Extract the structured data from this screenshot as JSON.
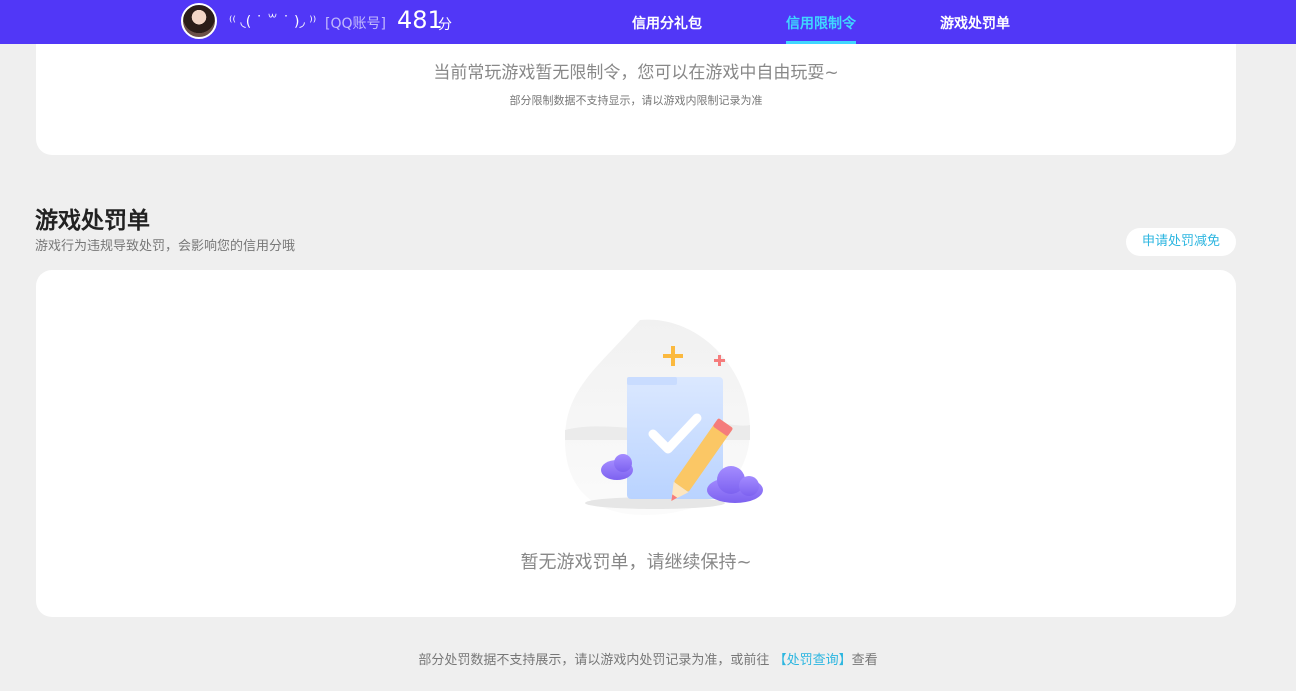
{
  "header": {
    "nickname": "⁽⁽ ◟( ˙ ꒳ ˙ )◞ ⁾⁾",
    "account_type": "[QQ账号]",
    "score": "481",
    "score_unit": "分",
    "tabs": [
      {
        "label": "信用分礼包",
        "active": false
      },
      {
        "label": "信用限制令",
        "active": true
      },
      {
        "label": "游戏处罚单",
        "active": false
      }
    ]
  },
  "limit_card": {
    "message": "当前常玩游戏暂无限制令，您可以在游戏中自由玩耍~",
    "note": "部分限制数据不支持显示，请以游戏内限制记录为准"
  },
  "penalty_section": {
    "title": "游戏处罚单",
    "subtitle": "游戏行为违规导致处罚，会影响您的信用分哦",
    "apply_button": "申请处罚减免",
    "empty_text": "暂无游戏罚单，请继续保持~",
    "illustration_icon": "clipboard-check-pencil-icon"
  },
  "footer": {
    "note_prefix": "部分处罚数据不支持展示，请以游戏内处罚记录为准，或前往",
    "link_text": "【处罚查询】",
    "note_suffix": "查看"
  },
  "colors": {
    "header_bg": "#5137f7",
    "active_tab": "#3fd7ff",
    "link": "#2cb6e0",
    "page_bg": "#efefef"
  }
}
